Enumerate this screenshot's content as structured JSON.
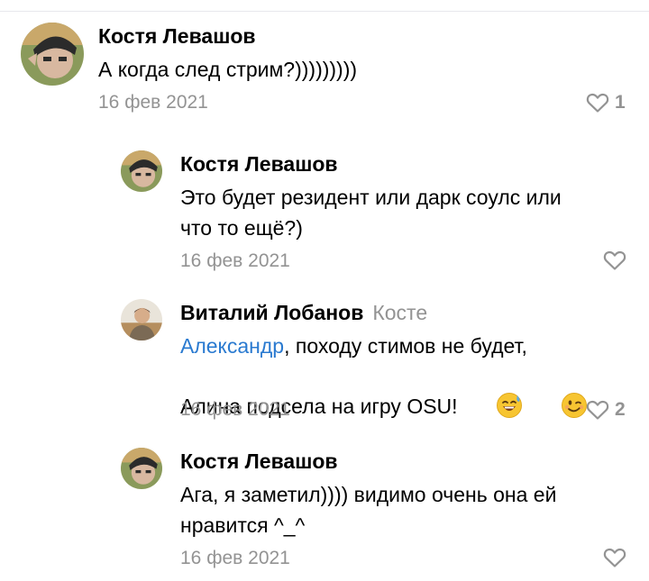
{
  "comments": [
    {
      "author": "Костя Левашов",
      "text": "А когда след стрим?)))))))))",
      "date": "16 фев 2021",
      "likes": "1",
      "avatar_icon": "user-avatar-photo"
    },
    {
      "author": "Костя Левашов",
      "text_line1": "Это будет резидент или дарк соулс или",
      "text_line2": "что то ещё?)",
      "date": "16 фев 2021",
      "likes": "",
      "avatar_icon": "user-avatar-photo"
    },
    {
      "author": "Виталий Лобанов",
      "reply_to": "Косте",
      "mention": "Александр",
      "text_line1_rest": ", походу стимов не будет,",
      "text_line2": "Алина подсела на игру OSU!",
      "emojis": [
        "sweat-smile-emoji",
        "wink-emoji"
      ],
      "date": "16 фев 2021",
      "likes": "2",
      "avatar_icon": "user-avatar-photo"
    },
    {
      "author": "Костя Левашов",
      "text_line1": "Ага, я заметил)))) видимо очень она ей",
      "text_line2": "нравится ^_^",
      "date": "16 фев 2021",
      "likes": "",
      "avatar_icon": "user-avatar-photo"
    }
  ],
  "icons": {
    "like": "heart-outline-icon"
  },
  "colors": {
    "link": "#2a7ad0",
    "meta": "#939393"
  }
}
